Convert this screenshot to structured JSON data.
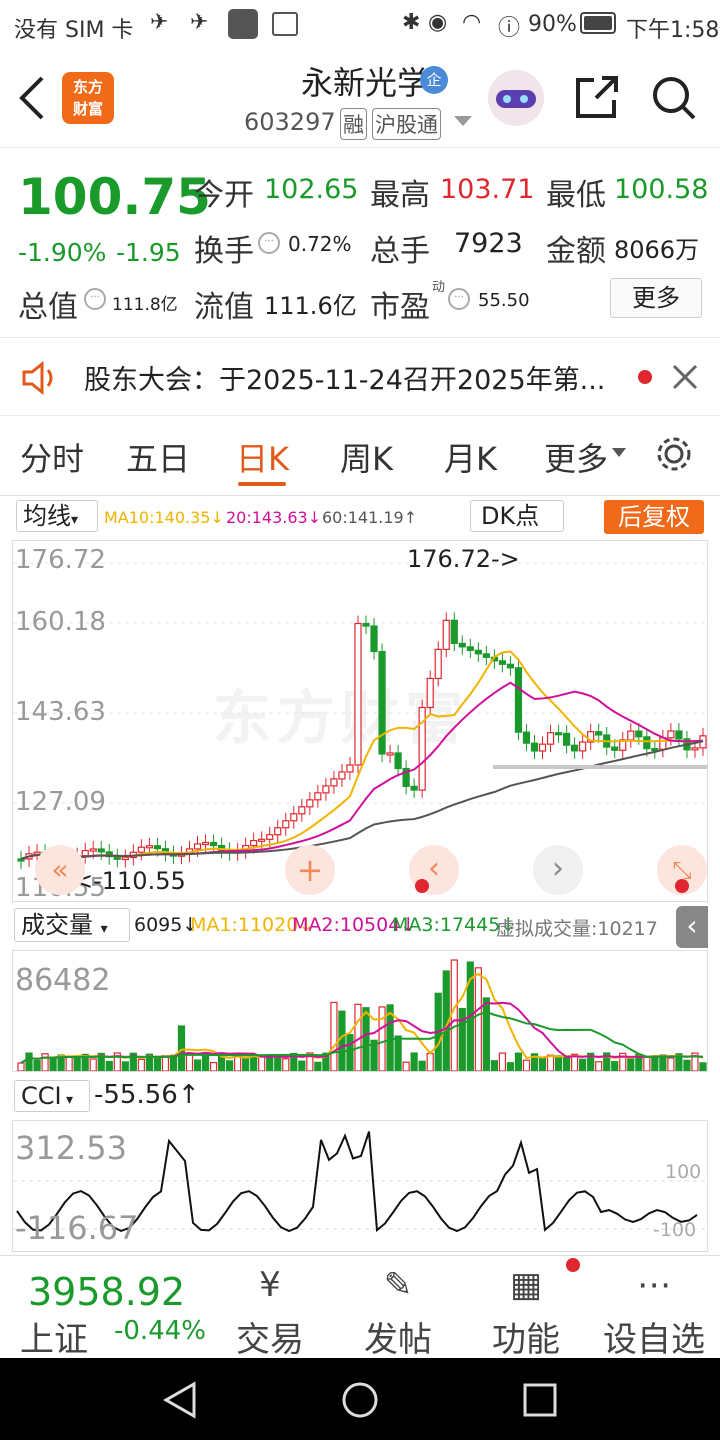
{
  "status_bar": {
    "carrier": "没有 SIM 卡",
    "battery": "90%",
    "time": "下午1:58"
  },
  "header": {
    "stock_name": "永新光学",
    "stock_code": "603297",
    "tag_margin": "融",
    "tag_connect": "沪股通",
    "app_logo_line1": "东方",
    "app_logo_line2": "财富",
    "company_badge": "企"
  },
  "quote": {
    "price": "100.75",
    "change_pct": "-1.90%",
    "change": "-1.95",
    "open_label": "今开",
    "open": "102.65",
    "high_label": "最高",
    "high": "103.71",
    "low_label": "最低",
    "low": "100.58",
    "turnover_label": "换手",
    "turnover": "0.72%",
    "volume_label": "总手",
    "volume": "7923",
    "amount_label": "金额",
    "amount": "8066万",
    "mktcap_label": "总值",
    "mktcap": "111.8亿",
    "float_label": "流值",
    "float": "111.6亿",
    "pe_label": "市盈",
    "pe_sup": "动",
    "pe": "55.50",
    "more_button": "更多"
  },
  "notice": {
    "text": "股东大会：于2025-11-24召开2025年第..."
  },
  "tabs": {
    "items": [
      "分时",
      "五日",
      "日K",
      "周K",
      "月K",
      "更多"
    ],
    "active": "日K"
  },
  "kline": {
    "ma_selector": "均线",
    "ma10": "MA10:140.35↓",
    "ma20": "20:143.63↓",
    "ma60": "60:141.19↑",
    "dk_button": "DK点",
    "adjust_button": "后复权",
    "y_labels": [
      "176.72",
      "160.18",
      "143.63",
      "127.09",
      "110.55"
    ],
    "high_marker": "176.72->",
    "low_marker": "<-110.55",
    "watermark": "东方财富"
  },
  "volume": {
    "selector": "成交量",
    "value": "6095↓",
    "ma1": "MA1:11020↓",
    "ma2": "MA2:10504↓",
    "ma3": "MA3:17445↓",
    "virtual": "虚拟成交量:10217",
    "y_max": "86482"
  },
  "cci": {
    "selector": "CCI",
    "value": "-55.56↑",
    "y_max": "312.53",
    "y_min": "-116.67",
    "ref_high": "100",
    "ref_low": "-100"
  },
  "bottom": {
    "index_value": "3958.92",
    "index_name": "上证",
    "index_change": "-0.44%",
    "tabs": [
      {
        "label": "交易",
        "icon": "trade-icon"
      },
      {
        "label": "发帖",
        "icon": "post-icon"
      },
      {
        "label": "功能",
        "icon": "function-icon"
      },
      {
        "label": "设自选",
        "icon": "more-icon"
      }
    ]
  },
  "colors": {
    "up": "#e0262e",
    "down": "#1b9a2c",
    "accent": "#e05a1a",
    "ma10": "#f0b400",
    "ma20": "#d0109a",
    "ma60": "#555555"
  }
}
